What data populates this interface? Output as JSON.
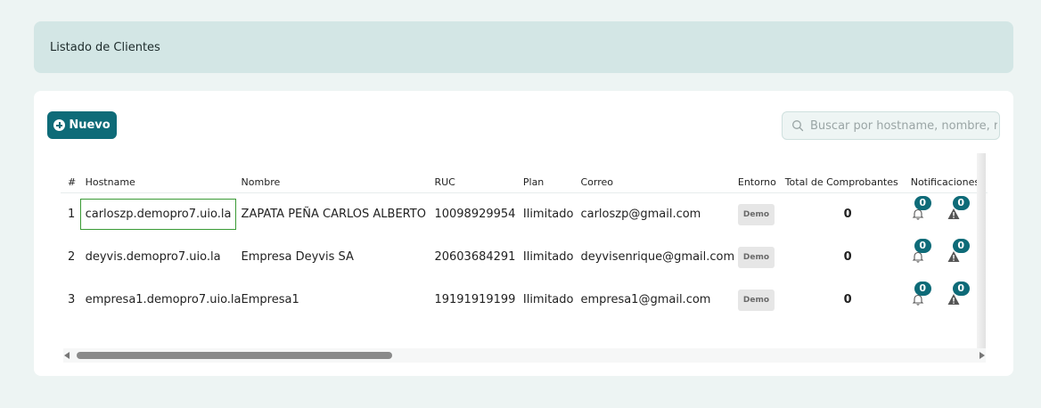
{
  "header": {
    "title": "Listado de Clientes"
  },
  "toolbar": {
    "new_label": "Nuevo",
    "search_placeholder": "Buscar por hostname, nombre, r"
  },
  "table": {
    "columns": [
      "#",
      "Hostname",
      "Nombre",
      "RUC",
      "Plan",
      "Correo",
      "Entorno",
      "Total de Comprobantes",
      "Notificaciones"
    ],
    "rows": [
      {
        "num": "1",
        "hostname": "carloszp.demopro7.uio.la",
        "nombre": "ZAPATA PEÑA CARLOS ALBERTO",
        "ruc": "10098929954",
        "plan": "Ilimitado",
        "correo": "carloszp@gmail.com",
        "entorno": "Demo",
        "total": "0",
        "notif_bell": "0",
        "notif_warn": "0"
      },
      {
        "num": "2",
        "hostname": "deyvis.demopro7.uio.la",
        "nombre": "Empresa Deyvis SA",
        "ruc": "20603684291",
        "plan": "Ilimitado",
        "correo": "deyvisenrique@gmail.com",
        "entorno": "Demo",
        "total": "0",
        "notif_bell": "0",
        "notif_warn": "0"
      },
      {
        "num": "3",
        "hostname": "empresa1.demopro7.uio.la",
        "nombre": "Empresa1",
        "ruc": "19191919199",
        "plan": "Ilimitado",
        "correo": "empresa1@gmail.com",
        "entorno": "Demo",
        "total": "0",
        "notif_bell": "0",
        "notif_warn": "0"
      }
    ]
  },
  "colors": {
    "accent": "#0e6b78",
    "header_bg": "#d3e6e5",
    "page_bg": "#edf4f3",
    "selection_border": "#3a9a35"
  },
  "icons": {
    "new": "plus-circle-icon",
    "search": "search-icon",
    "bell": "bell-icon",
    "warning": "warning-icon"
  }
}
